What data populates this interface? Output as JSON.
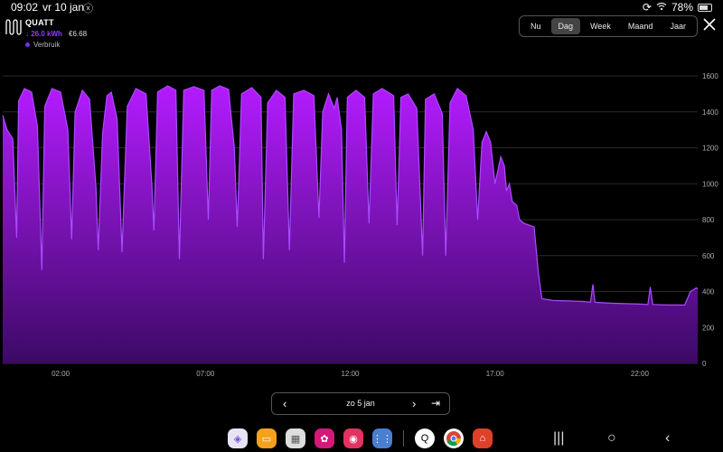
{
  "status": {
    "time": "09:02",
    "date": "vr 10 jan",
    "battery": "78%"
  },
  "header": {
    "brand": "QUATT",
    "energy": "↓ 26.0 kWh",
    "cost": "€6.68",
    "legend": "Verbruik"
  },
  "period_tabs": [
    {
      "label": "Nu",
      "active": false
    },
    {
      "label": "Dag",
      "active": true
    },
    {
      "label": "Week",
      "active": false
    },
    {
      "label": "Maand",
      "active": false
    },
    {
      "label": "Jaar",
      "active": false
    }
  ],
  "date_nav": {
    "label": "zo 5 jan"
  },
  "colors": {
    "accent": "#8e3cff",
    "fill_top": "#b41bff",
    "fill_bottom": "#3c0a66",
    "line": "#a94bff"
  },
  "dock_icons": [
    "vpn-icon",
    "files-icon",
    "grid-app-icon",
    "flower-app-icon",
    "camera-icon",
    "apps-icon",
    "q-app-icon",
    "chrome-icon",
    "home-app-icon"
  ],
  "chart_data": {
    "type": "area",
    "x_unit": "hours",
    "xlim": [
      0,
      24
    ],
    "ylim": [
      0,
      1600
    ],
    "x_ticks": [
      {
        "x": 2,
        "label": "02:00"
      },
      {
        "x": 7,
        "label": "07:00"
      },
      {
        "x": 12,
        "label": "12:00"
      },
      {
        "x": 17,
        "label": "17:00"
      },
      {
        "x": 22,
        "label": "22:00"
      }
    ],
    "y_ticks": [
      0,
      200,
      400,
      600,
      800,
      1000,
      1200,
      1400,
      1600
    ],
    "series": [
      {
        "name": "Verbruik",
        "points": [
          [
            0.0,
            1380
          ],
          [
            0.15,
            1300
          ],
          [
            0.35,
            1250
          ],
          [
            0.48,
            700
          ],
          [
            0.55,
            1460
          ],
          [
            0.75,
            1530
          ],
          [
            1.0,
            1510
          ],
          [
            1.2,
            1320
          ],
          [
            1.35,
            520
          ],
          [
            1.45,
            1430
          ],
          [
            1.7,
            1530
          ],
          [
            2.0,
            1510
          ],
          [
            2.25,
            1300
          ],
          [
            2.38,
            690
          ],
          [
            2.5,
            1400
          ],
          [
            2.75,
            1520
          ],
          [
            3.0,
            1470
          ],
          [
            3.22,
            980
          ],
          [
            3.3,
            630
          ],
          [
            3.45,
            1280
          ],
          [
            3.6,
            1490
          ],
          [
            3.75,
            1510
          ],
          [
            3.95,
            1360
          ],
          [
            4.12,
            620
          ],
          [
            4.3,
            1430
          ],
          [
            4.6,
            1530
          ],
          [
            4.95,
            1500
          ],
          [
            5.15,
            1000
          ],
          [
            5.22,
            740
          ],
          [
            5.35,
            1510
          ],
          [
            5.7,
            1545
          ],
          [
            5.98,
            1520
          ],
          [
            6.1,
            580
          ],
          [
            6.25,
            1520
          ],
          [
            6.6,
            1540
          ],
          [
            6.95,
            1520
          ],
          [
            7.1,
            800
          ],
          [
            7.22,
            1520
          ],
          [
            7.5,
            1545
          ],
          [
            7.8,
            1525
          ],
          [
            8.0,
            1200
          ],
          [
            8.1,
            760
          ],
          [
            8.25,
            1500
          ],
          [
            8.6,
            1535
          ],
          [
            8.92,
            1480
          ],
          [
            9.0,
            580
          ],
          [
            9.15,
            1450
          ],
          [
            9.45,
            1520
          ],
          [
            9.75,
            1480
          ],
          [
            9.9,
            630
          ],
          [
            10.05,
            1500
          ],
          [
            10.4,
            1520
          ],
          [
            10.75,
            1490
          ],
          [
            10.92,
            810
          ],
          [
            11.05,
            1400
          ],
          [
            11.25,
            1500
          ],
          [
            11.45,
            1420
          ],
          [
            11.55,
            1480
          ],
          [
            11.7,
            1300
          ],
          [
            11.8,
            560
          ],
          [
            11.9,
            1480
          ],
          [
            12.2,
            1520
          ],
          [
            12.5,
            1480
          ],
          [
            12.65,
            780
          ],
          [
            12.8,
            1500
          ],
          [
            13.1,
            1530
          ],
          [
            13.5,
            1490
          ],
          [
            13.62,
            770
          ],
          [
            13.75,
            1480
          ],
          [
            14.0,
            1500
          ],
          [
            14.3,
            1420
          ],
          [
            14.5,
            600
          ],
          [
            14.6,
            1470
          ],
          [
            14.9,
            1500
          ],
          [
            15.18,
            1390
          ],
          [
            15.3,
            600
          ],
          [
            15.45,
            1450
          ],
          [
            15.7,
            1530
          ],
          [
            16.0,
            1490
          ],
          [
            16.25,
            1300
          ],
          [
            16.4,
            800
          ],
          [
            16.55,
            1230
          ],
          [
            16.7,
            1290
          ],
          [
            16.85,
            1230
          ],
          [
            17.0,
            1000
          ],
          [
            17.2,
            1150
          ],
          [
            17.32,
            1100
          ],
          [
            17.4,
            960
          ],
          [
            17.5,
            1000
          ],
          [
            17.6,
            900
          ],
          [
            17.75,
            880
          ],
          [
            17.85,
            800
          ],
          [
            18.0,
            780
          ],
          [
            18.35,
            760
          ],
          [
            18.5,
            500
          ],
          [
            18.62,
            360
          ],
          [
            19.0,
            350
          ],
          [
            20.0,
            345
          ],
          [
            20.3,
            340
          ],
          [
            20.38,
            440
          ],
          [
            20.45,
            340
          ],
          [
            21.0,
            335
          ],
          [
            22.0,
            330
          ],
          [
            22.28,
            328
          ],
          [
            22.36,
            425
          ],
          [
            22.45,
            328
          ],
          [
            23.0,
            325
          ],
          [
            23.55,
            325
          ],
          [
            23.75,
            400
          ],
          [
            23.95,
            420
          ],
          [
            24.0,
            415
          ]
        ]
      }
    ],
    "grid": true
  }
}
